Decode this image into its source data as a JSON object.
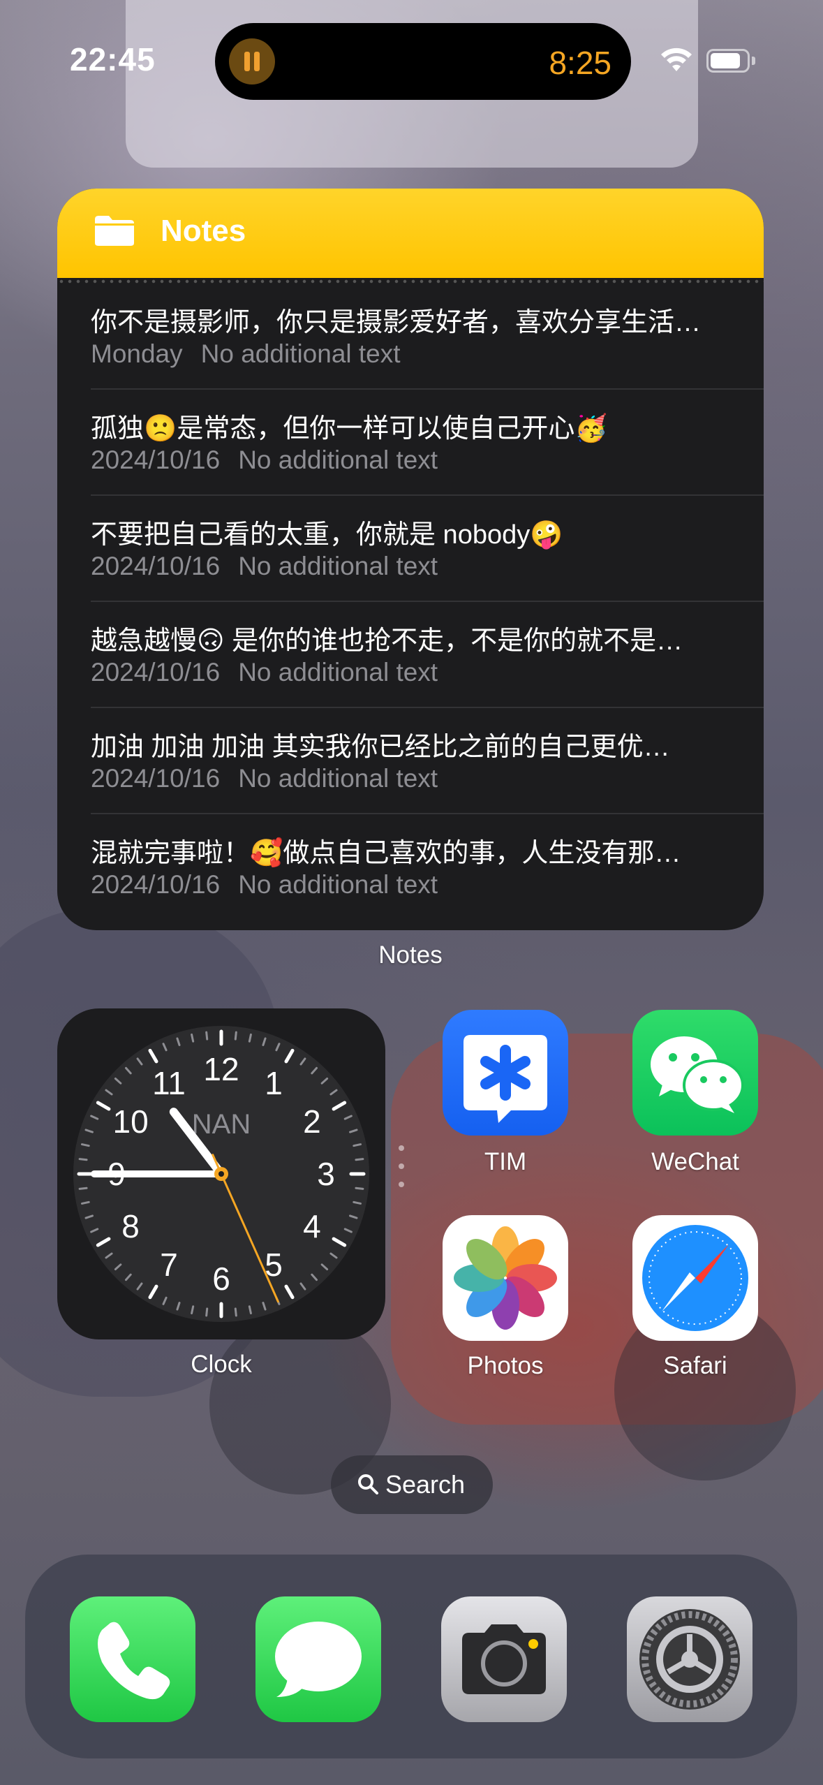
{
  "status_bar": {
    "time": "22:45",
    "timer": "8:25",
    "timer_color": "#f5a623"
  },
  "notes_widget": {
    "title": "Notes",
    "header_color": "#ffcc00",
    "label": "Notes",
    "notes": [
      {
        "title": "你不是摄影师，你只是摄影爱好者，喜欢分享生活…",
        "date": "Monday",
        "detail": "No additional text"
      },
      {
        "title": "孤独🙁是常态，但你一样可以使自己开心🥳",
        "date": "2024/10/16",
        "detail": "No additional text"
      },
      {
        "title": "不要把自己看的太重，你就是 nobody🤪",
        "date": "2024/10/16",
        "detail": "No additional text"
      },
      {
        "title": "越急越慢🙃 是你的谁也抢不走，不是你的就不是…",
        "date": "2024/10/16",
        "detail": "No additional text"
      },
      {
        "title": "加油  加油 加油 其实我你已经比之前的自己更优…",
        "date": "2024/10/16",
        "detail": "No additional text"
      },
      {
        "title": "混就完事啦！🥰做点自己喜欢的事，人生没有那…",
        "date": "2024/10/16",
        "detail": "No additional text"
      }
    ]
  },
  "clock_widget": {
    "label": "Clock",
    "city": "NAN",
    "numbers": [
      "12",
      "1",
      "2",
      "3",
      "4",
      "5",
      "6",
      "7",
      "8",
      "9",
      "10",
      "11"
    ],
    "second_hand_color": "#f5a623"
  },
  "apps": [
    {
      "name": "TIM",
      "icon": "tim-icon"
    },
    {
      "name": "WeChat",
      "icon": "wechat-icon"
    },
    {
      "name": "Photos",
      "icon": "photos-icon"
    },
    {
      "name": "Safari",
      "icon": "safari-icon"
    }
  ],
  "search": {
    "label": "Search"
  },
  "dock": [
    {
      "icon": "phone-icon",
      "color": "#34c759"
    },
    {
      "icon": "messages-icon",
      "color": "#34c759"
    },
    {
      "icon": "camera-icon",
      "color": "#bdbdc2"
    },
    {
      "icon": "settings-icon",
      "color": "#8e8e93"
    }
  ]
}
